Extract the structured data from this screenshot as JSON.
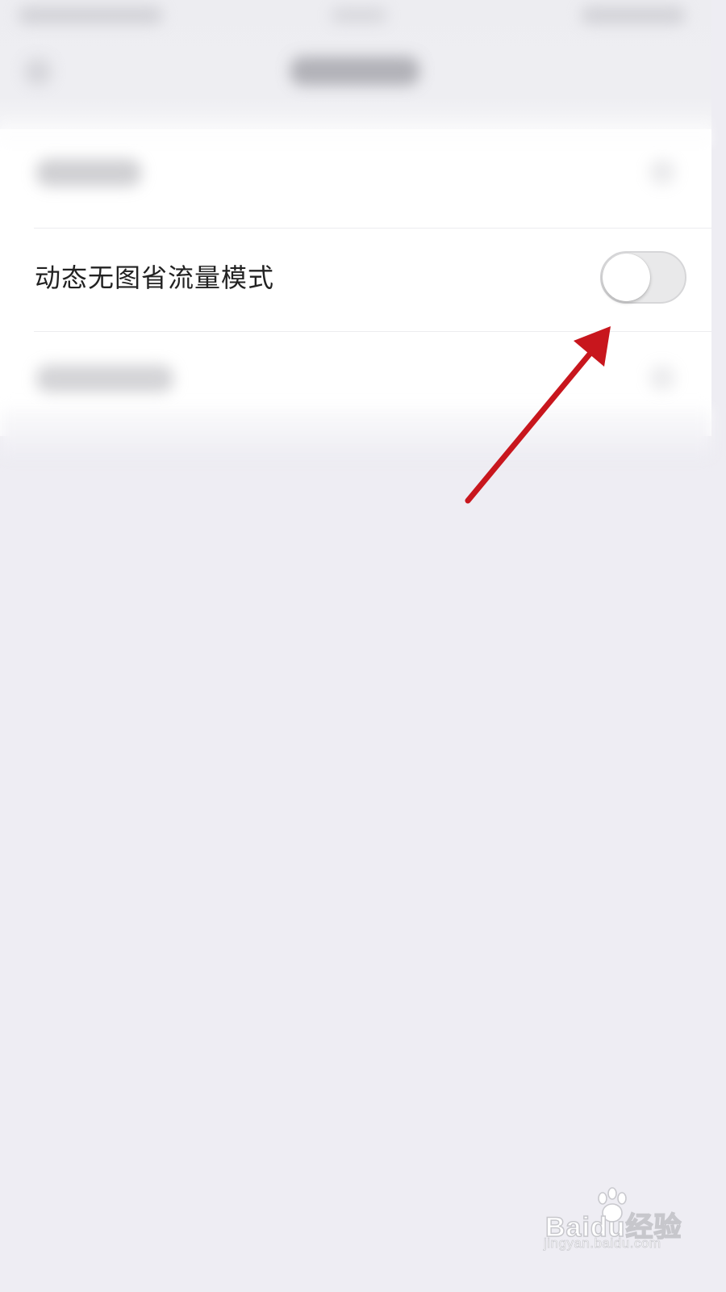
{
  "setting_row": {
    "label": "动态无图省流量模式",
    "toggle_state": "off"
  },
  "annotation": {
    "arrow_color": "#c8161d"
  },
  "watermark": {
    "brand": "Baidu经验",
    "url": "jingyan.baidu.com"
  },
  "colors": {
    "background": "#eeedf3",
    "card": "#ffffff",
    "toggle_track": "#e9e9ea",
    "toggle_knob": "#ffffff",
    "label_text": "#222222"
  }
}
